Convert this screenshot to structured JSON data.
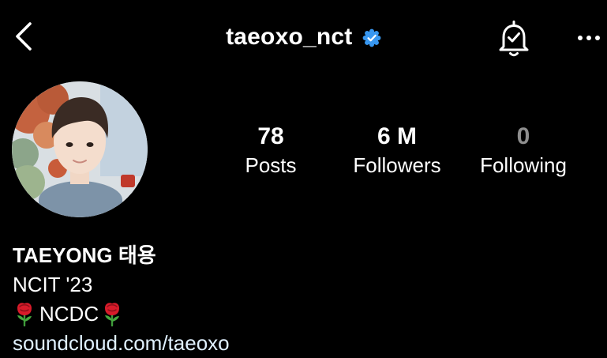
{
  "header": {
    "username": "taeoxo_nct",
    "back_icon": "chevron-left-icon",
    "verified_icon": "verified-badge-icon",
    "notification_icon": "bell-check-icon",
    "more_icon": "more-horizontal-icon"
  },
  "profile": {
    "avatar": "profile-photo",
    "stats": [
      {
        "value": "78",
        "label": "Posts"
      },
      {
        "value": "6 M",
        "label": "Followers"
      },
      {
        "value": "0",
        "label": "Following"
      }
    ],
    "bio": {
      "name": "TAEYONG 태용",
      "line1": "NCIT '23",
      "line2_text": "NCDC",
      "line2_emoji": "rose-emoji",
      "link": "soundcloud.com/taeoxo"
    }
  },
  "colors": {
    "background": "#000000",
    "text": "#ffffff",
    "muted": "#8e8e8e",
    "verified": "#3897f0",
    "link": "#e0f1ff"
  }
}
